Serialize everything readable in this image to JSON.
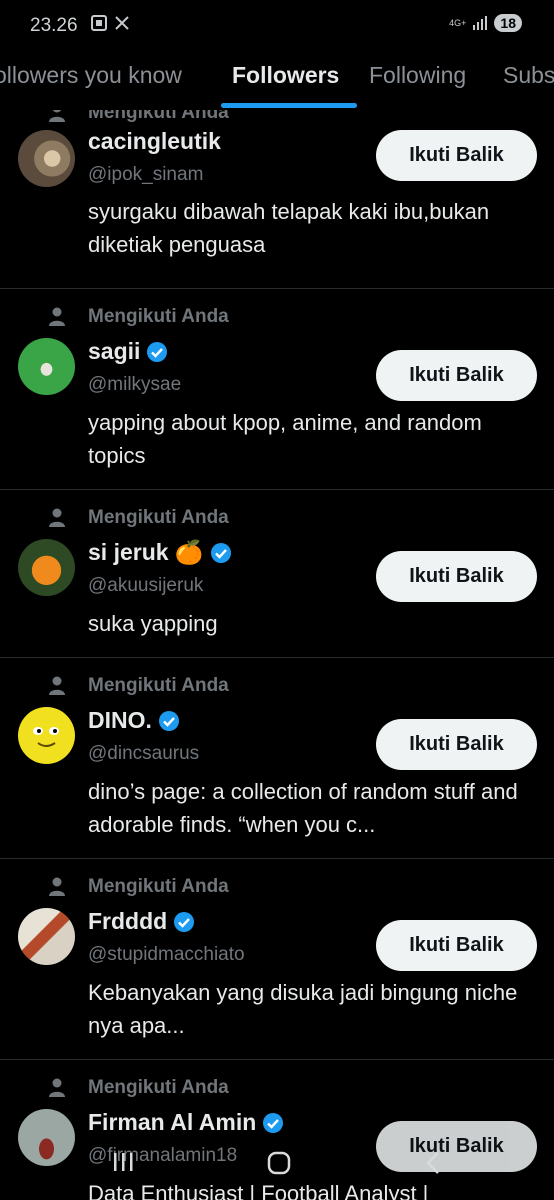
{
  "status": {
    "time": "23.26",
    "network": "4G+",
    "battery": "18"
  },
  "tabs": [
    {
      "label": "ollowers you know"
    },
    {
      "label": "Followers"
    },
    {
      "label": "Following"
    },
    {
      "label": "Subs"
    }
  ],
  "context_label": "Mengikuti Anda",
  "follow_back_label": "Ikuti Balik",
  "users": [
    {
      "name": "cacingleutik",
      "handle": "@ipok_sinam",
      "bio": "syurgaku dibawah telapak kaki ibu,bukan diketiak penguasa",
      "verified": false
    },
    {
      "name": "sagii",
      "handle": "@milkysae",
      "bio": "yapping about kpop, anime, and random topics",
      "verified": true
    },
    {
      "name": "si jeruk 🍊",
      "handle": "@akuusijeruk",
      "bio": "suka yapping",
      "verified": true
    },
    {
      "name": "DINO.",
      "handle": "@dincsaurus",
      "bio": "dino’s page: a collection of random stuff and adorable finds. “when you c...",
      "verified": true
    },
    {
      "name": "Frdddd",
      "handle": "@stupidmacchiato",
      "bio": "Kebanyakan yang disuka jadi bingung niche nya apa...",
      "verified": true
    },
    {
      "name": "Firman Al Amin",
      "handle": "@firmanalamin18",
      "bio": "Data Enthusiast | Football Analyst |",
      "verified": true
    }
  ],
  "colors": {
    "accent": "#1d9bf0",
    "background": "#000000",
    "button": "#eff3f4"
  },
  "icons": {
    "context": "person-icon",
    "verified": "verified-badge-icon"
  }
}
